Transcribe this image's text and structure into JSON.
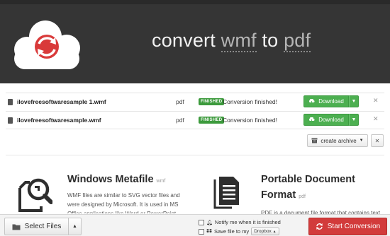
{
  "header": {
    "title_prefix": "convert",
    "source_format": "wmf",
    "title_middle": "to",
    "target_format": "pdf"
  },
  "files": [
    {
      "name": "ilovefreesoftwaresample 1.wmf",
      "target": "pdf",
      "badge": "FINISHED",
      "status": "Conversion finished!",
      "download_label": "Download"
    },
    {
      "name": "ilovefreesoftwaresample.wmf",
      "target": "pdf",
      "badge": "FINISHED",
      "status": "Conversion finished!",
      "download_label": "Download"
    }
  ],
  "archive": {
    "label": "create archive"
  },
  "info_left": {
    "title": "Windows Metafile",
    "ext": "wmf",
    "body": "WMF files are similar to SVG vector files and were designed by Microsoft. It is used in MS Office applications like Word or PowerPoint."
  },
  "info_right": {
    "title_line1": "Portable Document",
    "title_line2": "Format",
    "ext": "pdf",
    "body": "PDF is a document file format that contains text,"
  },
  "bottom": {
    "select_label": "Select Files",
    "notify_label": "Notify me when it is finished",
    "save_label": "Save file to my",
    "dropbox_label": "Dropbox",
    "start_label": "Start Conversion"
  },
  "colors": {
    "header_bg": "#353535",
    "download_green": "#4caf50",
    "start_red": "#d23b3b",
    "logo_red": "#d93a3a"
  },
  "icons": {
    "logo": "cloud-convert-icon",
    "file": "file-icon",
    "download": "cloud-download-icon",
    "wmf": "search-document-icon",
    "pdf": "document-icon",
    "select": "folder-icon",
    "start": "refresh-icon"
  }
}
